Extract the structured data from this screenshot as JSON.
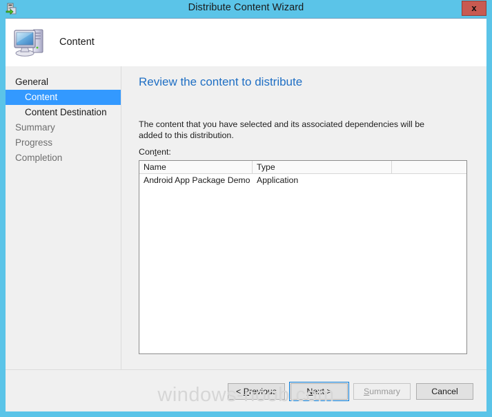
{
  "window": {
    "title": "Distribute Content Wizard",
    "titlebar_icon": "distribute-content-icon",
    "close_label": "x",
    "frame_color": "#5BC4E8",
    "titlebar_color": "#5BC4E8",
    "close_button_color": "#C85A51"
  },
  "header": {
    "icon": "computer-icon",
    "title": "Content"
  },
  "sidebar": {
    "items": [
      {
        "label": "General",
        "state": "group"
      },
      {
        "label": "Content",
        "state": "selected"
      },
      {
        "label": "Content Destination",
        "state": "child"
      },
      {
        "label": "Summary",
        "state": "dimmed"
      },
      {
        "label": "Progress",
        "state": "dimmed"
      },
      {
        "label": "Completion",
        "state": "dimmed"
      }
    ],
    "selected_color": "#3399FF"
  },
  "content": {
    "heading": "Review the content to distribute",
    "heading_color": "#1F6FC4",
    "intro_text": "The content that you have selected and its associated dependencies will be added to this distribution.",
    "list_label_prefix": "Con",
    "list_label_accel": "t",
    "list_label_suffix": "ent:",
    "list": {
      "columns": [
        "Name",
        "Type"
      ],
      "rows": [
        {
          "name": "Android App Package Demo",
          "type": "Application"
        }
      ]
    }
  },
  "footer": {
    "buttons": [
      {
        "prefix": "< ",
        "accel": "P",
        "suffix": "revious",
        "state": "enabled"
      },
      {
        "prefix": "",
        "accel": "N",
        "suffix": "ext >",
        "state": "focused"
      },
      {
        "prefix": "",
        "accel": "S",
        "suffix": "ummary",
        "state": "disabled"
      },
      {
        "prefix": "",
        "accel": "C",
        "suffix": "ancel",
        "state": "enabled",
        "no_underline": true
      }
    ]
  },
  "watermark": {
    "text": "windows-noob.com",
    "color": "#D6D6D6"
  }
}
